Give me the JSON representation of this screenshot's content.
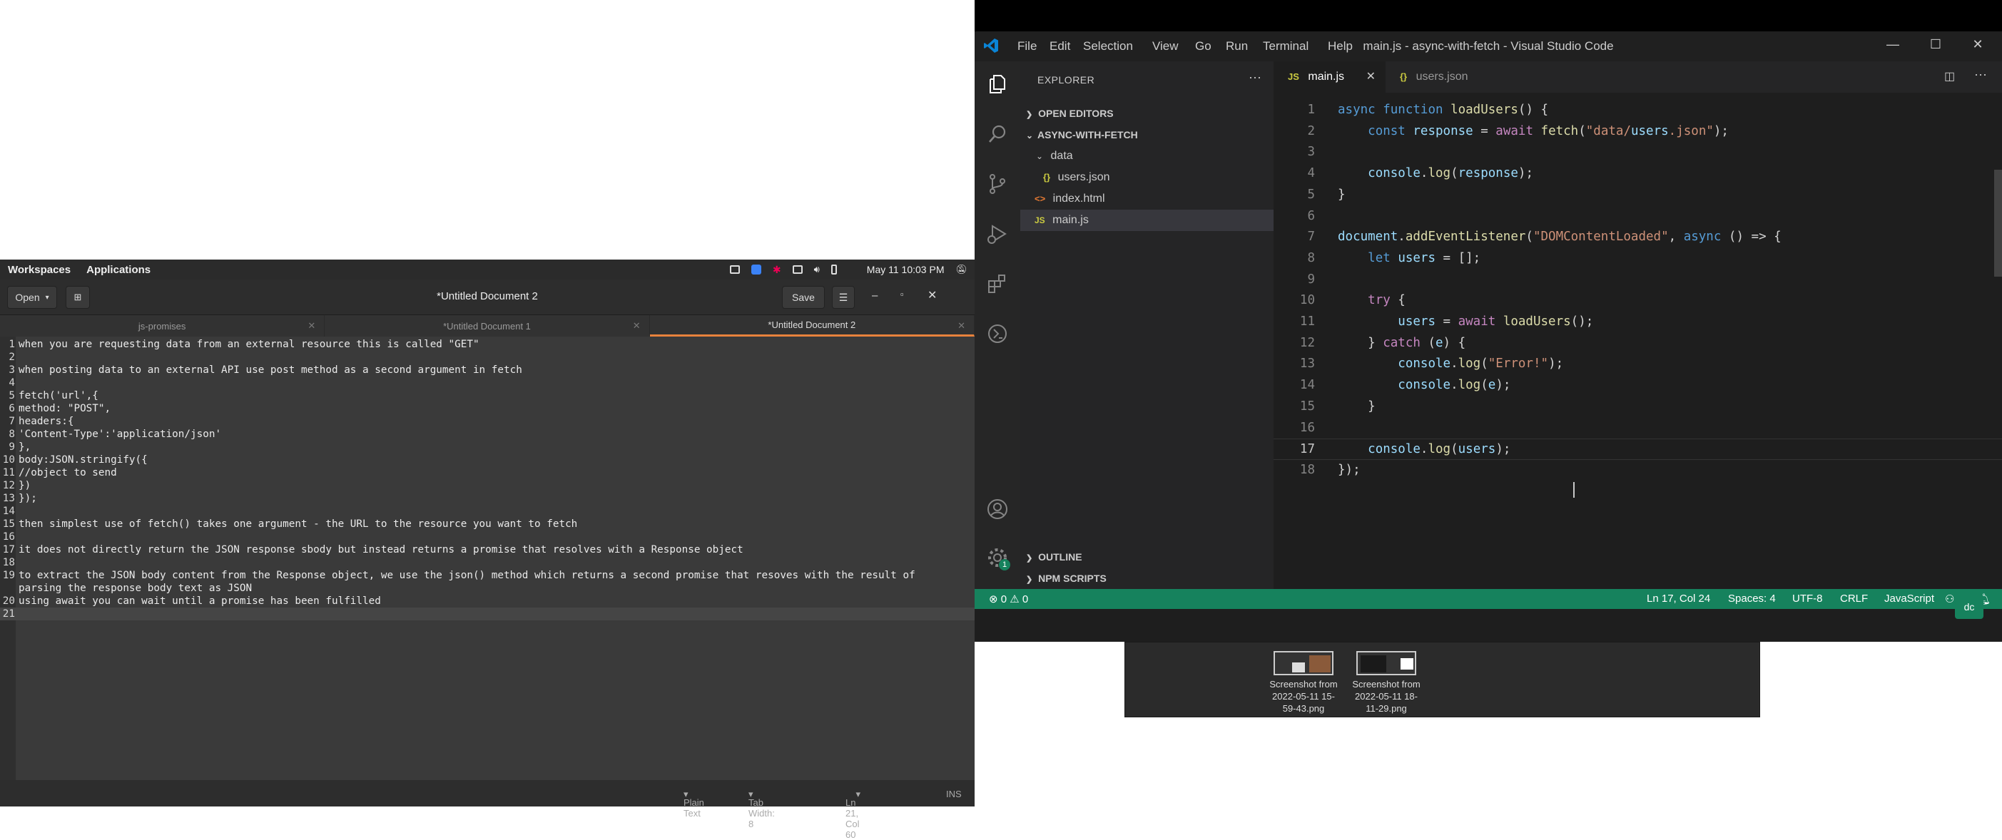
{
  "gnome_panel": {
    "workspaces": "Workspaces",
    "applications": "Applications",
    "datetime": "May 11  10:03 PM"
  },
  "gedit": {
    "open_label": "Open",
    "title": "*Untitled Document 2",
    "save_label": "Save",
    "tabs": [
      {
        "label": "js-promises",
        "active": false
      },
      {
        "label": "*Untitled Document 1",
        "active": false
      },
      {
        "label": "*Untitled Document 2",
        "active": true
      }
    ],
    "lines": [
      "when you are requesting data from an external resource this is called \"GET\"",
      "",
      "when posting data to an external API use post method as a second argument in fetch",
      "",
      "fetch('url',{",
      "method: \"POST\",",
      "headers:{",
      "'Content-Type':'application/json'",
      "},",
      "body:JSON.stringify({",
      "//object to send",
      "})",
      "});",
      "",
      "then simplest use of fetch() takes one argument - the URL to the resource you want to fetch",
      "",
      "it does not directly return the JSON response sbody but instead returns a promise that resolves with a Response object",
      "",
      "to extract the JSON body content from the Response object, we use the json() method which returns a second promise that resoves with the result of",
      "parsing the response body text as JSON",
      "using await you can wait until a promise has been fulfilled"
    ],
    "line_numbers": [
      "1",
      "2",
      "3",
      "4",
      "5",
      "6",
      "7",
      "8",
      "9",
      "10",
      "11",
      "12",
      "13",
      "14",
      "15",
      "16",
      "17",
      "18",
      "19",
      "",
      "20",
      "21"
    ],
    "status": {
      "language": "Plain Text",
      "tab_width": "Tab Width: 8",
      "position": "Ln 21, Col 60",
      "mode": "INS"
    }
  },
  "vscode": {
    "menu": [
      "File",
      "Edit",
      "Selection",
      "View",
      "Go",
      "Run",
      "Terminal",
      "Help"
    ],
    "window_title": "main.js - async-with-fetch - Visual Studio Code",
    "explorer": {
      "header": "EXPLORER",
      "open_editors": "OPEN EDITORS",
      "project": "ASYNC-WITH-FETCH",
      "folder": "data",
      "file_users": "users.json",
      "file_index": "index.html",
      "file_main": "main.js",
      "outline": "OUTLINE",
      "npm": "NPM SCRIPTS",
      "icon_json": "{}",
      "icon_html": "<>",
      "icon_js": "JS"
    },
    "tabs": [
      {
        "icon": "JS",
        "label": "main.js",
        "active": true
      },
      {
        "icon": "{}",
        "label": "users.json",
        "active": false
      }
    ],
    "code_lines": [
      "async function loadUsers() {",
      "    const response = await fetch(\"data/users.json\");",
      "",
      "    console.log(response);",
      "}",
      "",
      "document.addEventListener(\"DOMContentLoaded\", async () => {",
      "    let users = [];",
      "",
      "    try {",
      "        users = await loadUsers();",
      "    } catch (e) {",
      "        console.log(\"Error!\");",
      "        console.log(e);",
      "    }",
      "",
      "    console.log(users);",
      "});"
    ],
    "status": {
      "problems": "⊗ 0 ⚠ 0",
      "position": "Ln 17, Col 24",
      "spaces": "Spaces: 4",
      "encoding": "UTF-8",
      "eol": "CRLF",
      "language": "JavaScript"
    },
    "accounts_badge": "1"
  },
  "shelf": {
    "items": [
      {
        "label": "Screenshot from 2022-05-11 15-59-43.png"
      },
      {
        "label": "Screenshot from 2022-05-11 18-11-29.png"
      }
    ]
  },
  "colors": {
    "gedit_accent": "#e8823c",
    "vscode_status": "#16825d",
    "vscode_bg": "#1e1e1e"
  }
}
